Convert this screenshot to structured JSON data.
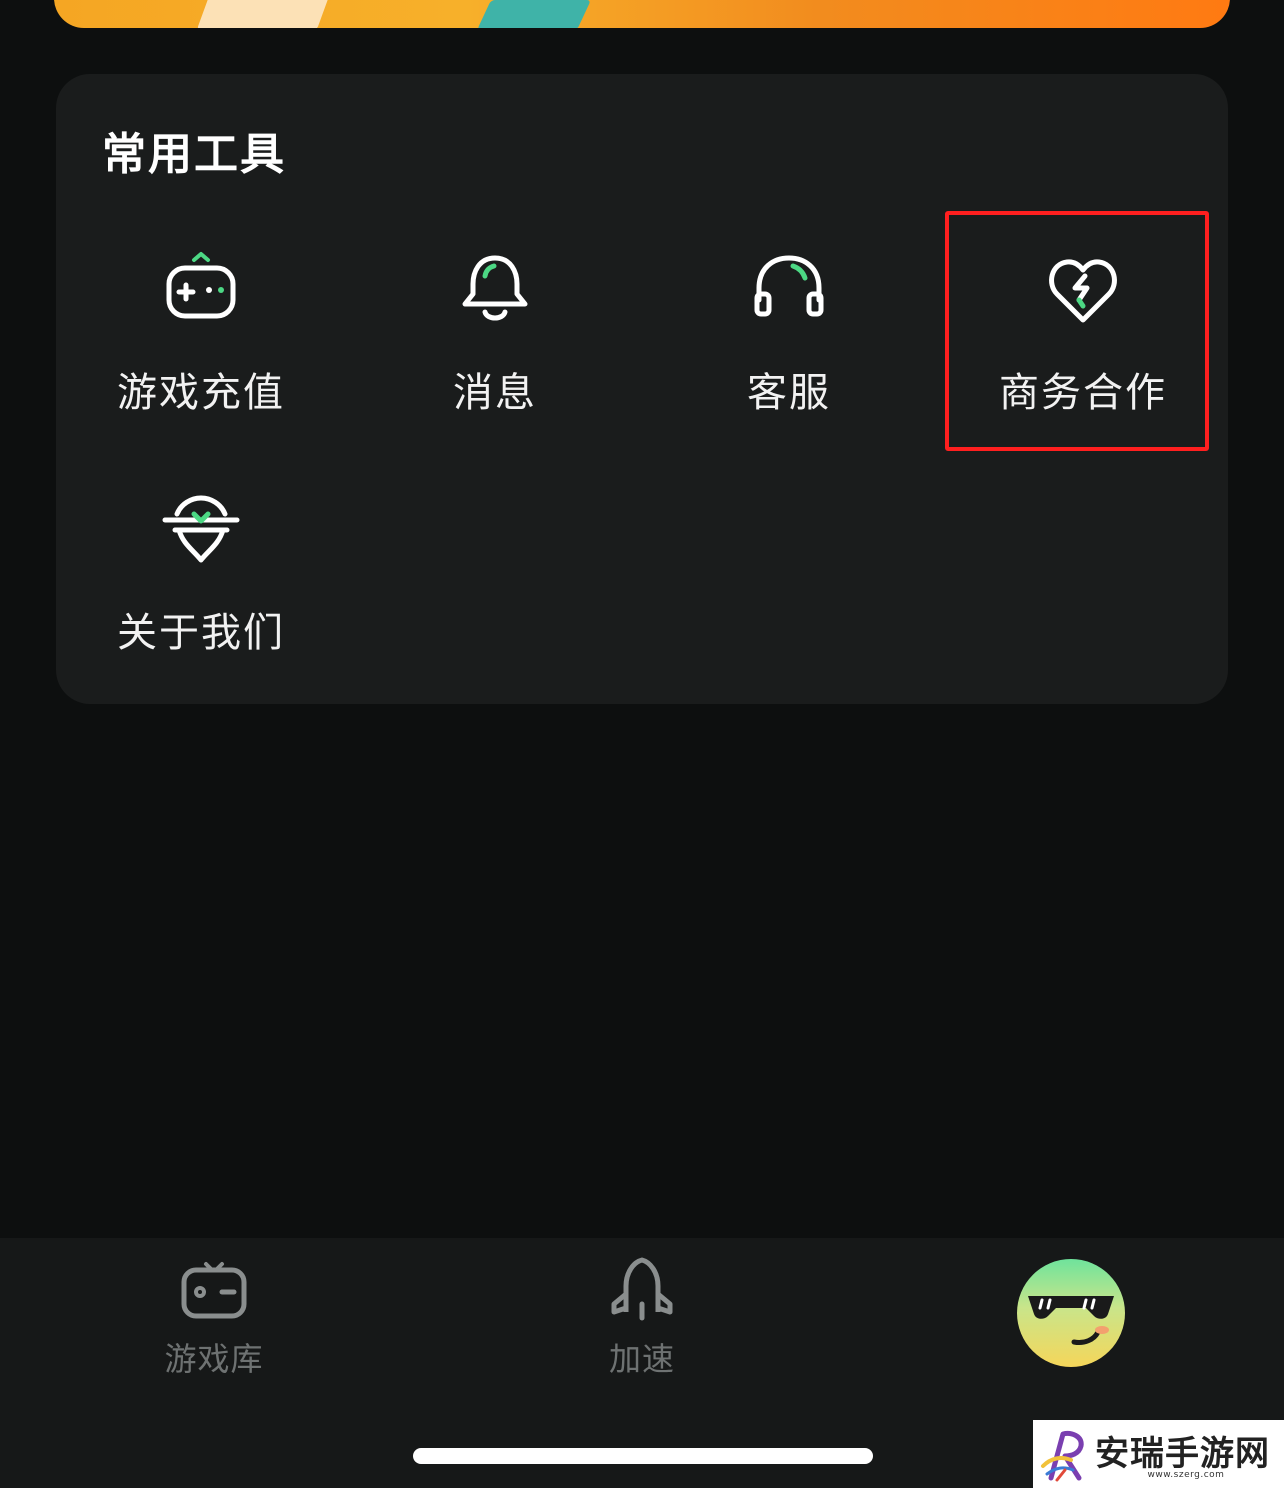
{
  "section": {
    "title": "常用工具"
  },
  "tools": [
    {
      "label": "游戏充值",
      "icon": "gamepad-recharge-icon"
    },
    {
      "label": "消息",
      "icon": "bell-icon"
    },
    {
      "label": "客服",
      "icon": "headset-icon"
    },
    {
      "label": "商务合作",
      "icon": "heart-handshake-icon"
    },
    {
      "label": "关于我们",
      "icon": "about-heart-logo-icon"
    }
  ],
  "tabbar": {
    "tabs": [
      {
        "label": "游戏库",
        "icon": "gamepad-icon"
      },
      {
        "label": "加速",
        "icon": "rocket-icon"
      }
    ],
    "profile": {
      "icon": "avatar-sunglasses-face"
    }
  },
  "watermark": {
    "text": "安瑞手游网",
    "url": "www.szerg.com"
  },
  "colors": {
    "accent": "#4cd884",
    "highlight_border": "#ff1f1f",
    "background": "#0d0f0f",
    "card": "#1a1c1c"
  }
}
